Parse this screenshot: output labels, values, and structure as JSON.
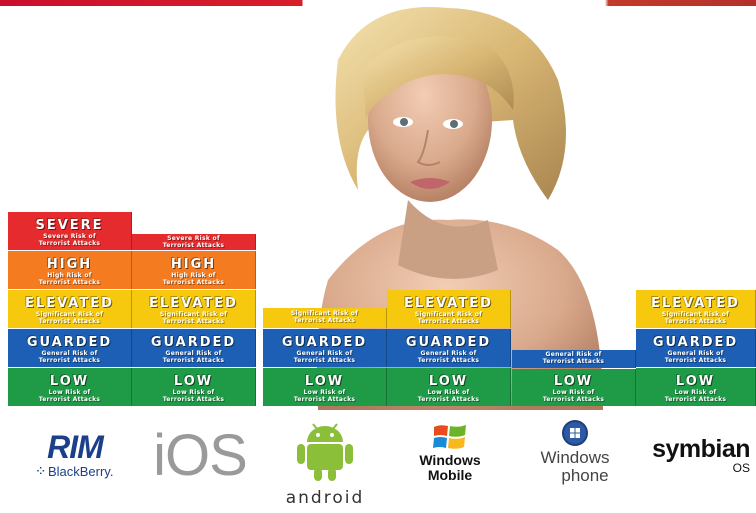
{
  "colors": {
    "severe": "#e52b2d",
    "high": "#f47b20",
    "elevated": "#f7c90e",
    "guarded": "#1d5fb4",
    "low": "#1f9a47",
    "android_green": "#8bbf3a"
  },
  "levels": {
    "severe": {
      "title": "SEVERE",
      "desc": "Severe Risk of\nTerrorist Attacks"
    },
    "high": {
      "title": "HIGH",
      "desc": "High Risk of\nTerrorist Attacks"
    },
    "elevated": {
      "title": "ELEVATED",
      "desc": "Significant Risk of\nTerrorist Attacks"
    },
    "guarded": {
      "title": "GUARDED",
      "desc": "General Risk of\nTerrorist Attacks"
    },
    "low": {
      "title": "LOW",
      "desc": "Low Risk of\nTerrorist Attacks"
    }
  },
  "platforms": [
    {
      "name": "BlackBerry",
      "top_level": "severe",
      "logo_text": "RIM",
      "logo_sub": "BlackBerry."
    },
    {
      "name": "iOS",
      "top_level": "high",
      "logo_text": "iOS"
    },
    {
      "name": "Android",
      "top_level": "elevated",
      "logo_text": "android"
    },
    {
      "name": "Windows Mobile",
      "top_level": "elevated",
      "logo_text": "Windows",
      "logo_sub": "Mobile"
    },
    {
      "name": "Windows phone",
      "top_level": "guarded",
      "logo_text": "Windows",
      "logo_sub": "phone"
    },
    {
      "name": "Symbian",
      "top_level": "elevated",
      "logo_text": "symbian",
      "logo_sub": "OS"
    }
  ]
}
